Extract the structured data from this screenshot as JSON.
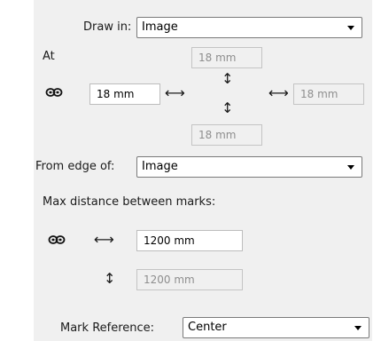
{
  "draw_in": {
    "label": "Draw in:",
    "value": "Image"
  },
  "at": {
    "label": "At",
    "top": "18 mm",
    "left": "18 mm",
    "right": "18 mm",
    "bottom": "18 mm"
  },
  "from_edge": {
    "label": "From edge of:",
    "value": "Image"
  },
  "max_distance": {
    "label": "Max distance between marks:",
    "horizontal": "1200 mm",
    "vertical": "1200 mm"
  },
  "mark_reference": {
    "label": "Mark Reference:",
    "value": "Center"
  },
  "glyphs": {
    "horizontal_arrow": "⟷",
    "vertical_arrow": "↕"
  },
  "icons": {
    "link": "link-icon",
    "dropdown_arrow": "chevron-down-icon"
  },
  "colors": {
    "panel_bg": "#f0f0f0",
    "field_bg": "#ffffff",
    "disabled_text": "#8e8e8e",
    "border": "#7a7a7a"
  }
}
